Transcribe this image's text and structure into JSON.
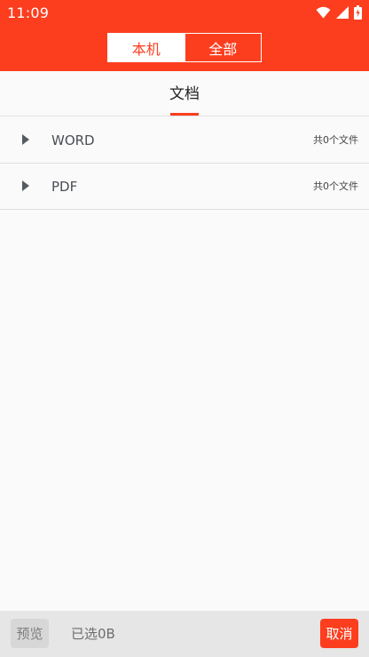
{
  "status_bar": {
    "time": "11:09",
    "icons": [
      "wifi-icon",
      "cellular-signal-icon",
      "battery-charging-icon"
    ]
  },
  "segmented_tabs": [
    {
      "label": "本机",
      "active": true
    },
    {
      "label": "全部",
      "active": false
    }
  ],
  "category_tabs": [
    {
      "label": "文档",
      "active": true
    }
  ],
  "file_groups": [
    {
      "label": "WORD",
      "count_text": "共0个文件",
      "icon": "triangle-right-icon"
    },
    {
      "label": "PDF",
      "count_text": "共0个文件",
      "icon": "triangle-right-icon"
    }
  ],
  "bottom_bar": {
    "preview_label": "预览",
    "selected_text": "已选0B",
    "cancel_label": "取消"
  },
  "colors": {
    "accent": "#fc3e1f",
    "background": "#fafafa",
    "bottom_bar": "#e6e6e6"
  }
}
